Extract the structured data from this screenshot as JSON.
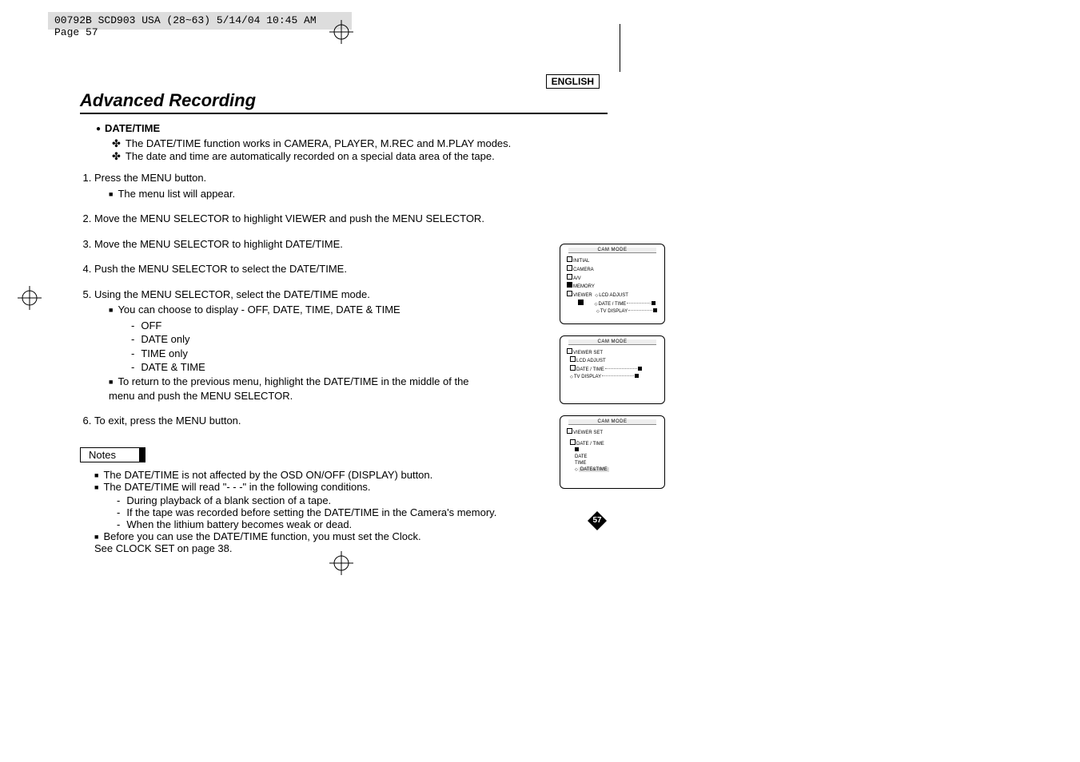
{
  "header": "00792B SCD903 USA (28~63)  5/14/04 10:45 AM  Page 57",
  "lang": "ENGLISH",
  "title": "Advanced Recording",
  "section": "DATE/TIME",
  "intro": [
    "The DATE/TIME function works in CAMERA, PLAYER, M.REC and M.PLAY modes.",
    "The date and time are automatically recorded on a special data area of the tape."
  ],
  "steps": {
    "s1": "Press the MENU button.",
    "s1a": "The menu list will appear.",
    "s2": "Move the MENU SELECTOR to highlight VIEWER and push the MENU SELECTOR.",
    "s3": "Move the MENU SELECTOR to highlight DATE/TIME.",
    "s4": "Push the MENU SELECTOR to select the DATE/TIME.",
    "s5": "Using the MENU SELECTOR, select the DATE/TIME mode.",
    "s5a": "You can choose to display - OFF, DATE, TIME, DATE & TIME",
    "s5opts": [
      "OFF",
      "DATE only",
      "TIME only",
      "DATE & TIME"
    ],
    "s5b": "To return to the previous menu, highlight the DATE/TIME in the middle of the menu and push the MENU SELECTOR.",
    "s6": "To exit, press the MENU button."
  },
  "notes_label": "Notes",
  "notes": {
    "n1": "The DATE/TIME is not affected by the OSD ON/OFF (DISPLAY) button.",
    "n2": "The DATE/TIME will read \"- - -\" in the following conditions.",
    "n2subs": [
      "During playback of a blank section of a tape.",
      "If the tape was recorded before setting the DATE/TIME in the Camera's memory.",
      "When the lithium battery becomes weak or dead."
    ],
    "n3": "Before you can use the DATE/TIME function, you must set the Clock.",
    "n3b": "See CLOCK SET on page 38."
  },
  "diag": {
    "cam_mode": "CAM  MODE",
    "initial": "INITIAL",
    "camera": "CAMERA",
    "av": "A/V",
    "memory": "MEMORY",
    "viewer": "VIEWER",
    "lcd_adjust": "LCD ADJUST",
    "date_time": "DATE / TIME",
    "tv_display": "TV DISPLAY",
    "viewer_set": "VIEWER SET",
    "date_time2": "DATE / TIME",
    "date": "DATE",
    "time": "TIME",
    "datetime": "DATE&TIME"
  },
  "page": "57"
}
